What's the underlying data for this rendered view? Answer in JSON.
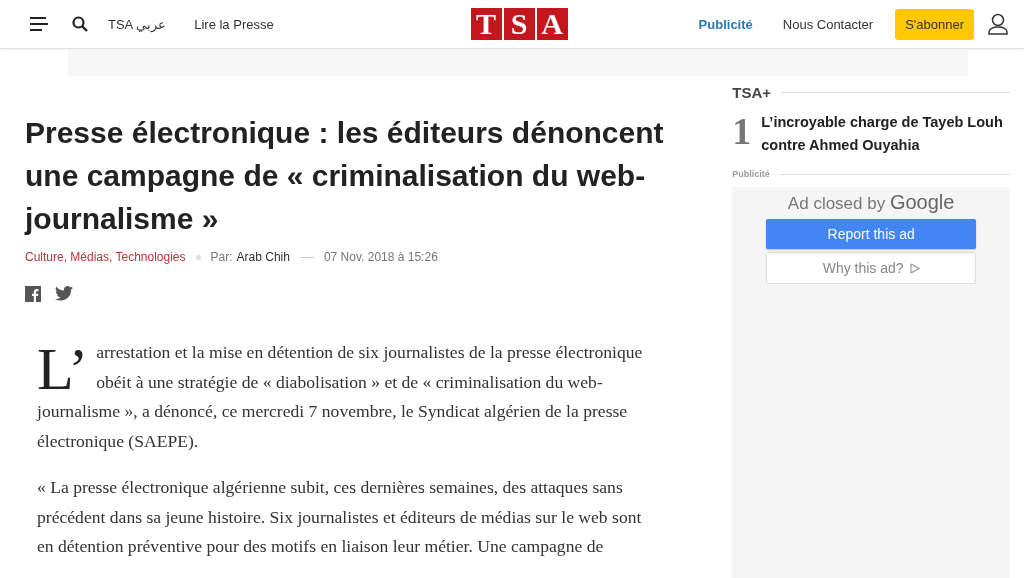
{
  "header": {
    "logo": [
      "T",
      "S",
      "A"
    ],
    "nav_left": [
      "TSA عربي",
      "Lire la Presse"
    ],
    "nav_right": [
      {
        "label": "Publicité",
        "kind": "link"
      },
      {
        "label": "Nous Contacter",
        "kind": "plain"
      }
    ],
    "subscribe": "S'abonner"
  },
  "article": {
    "title": "Presse électronique : les éditeurs dénoncent une campagne de « criminalisation du web-journalisme »",
    "categories": "Culture, Médias, Technologies",
    "author_label": "Par:",
    "author": "Arab Chih",
    "date": "07 Nov. 2018 à 15:26",
    "drop_cap": "L’",
    "lead": "arrestation et la mise en détention de six journalistes de la presse électronique obéit à une stratégie de « diabolisation » et de « criminalisation du web-journalisme », a dénoncé, ce mercredi 7 novembre, le Syndicat algérien de la presse électronique (SAEPE).",
    "paragraphs": [
      "« La presse électronique algérienne subit, ces dernières semaines, des attaques sans précédent dans sa jeune histoire. Six journalistes et éditeurs de médias sur le web sont en détention préventive pour des motifs en liaison leur métier. Une campagne de"
    ]
  },
  "sidebar": {
    "section": "TSA+",
    "items": [
      {
        "rank": "1",
        "title": "L’incroyable charge de Tayeb Louh contre Ahmed Ouyahia"
      }
    ],
    "ad_label": "Publicité",
    "ad": {
      "closed_text": "Ad closed by ",
      "brand": "Google",
      "report": "Report this ad",
      "why": "Why this ad?"
    }
  }
}
